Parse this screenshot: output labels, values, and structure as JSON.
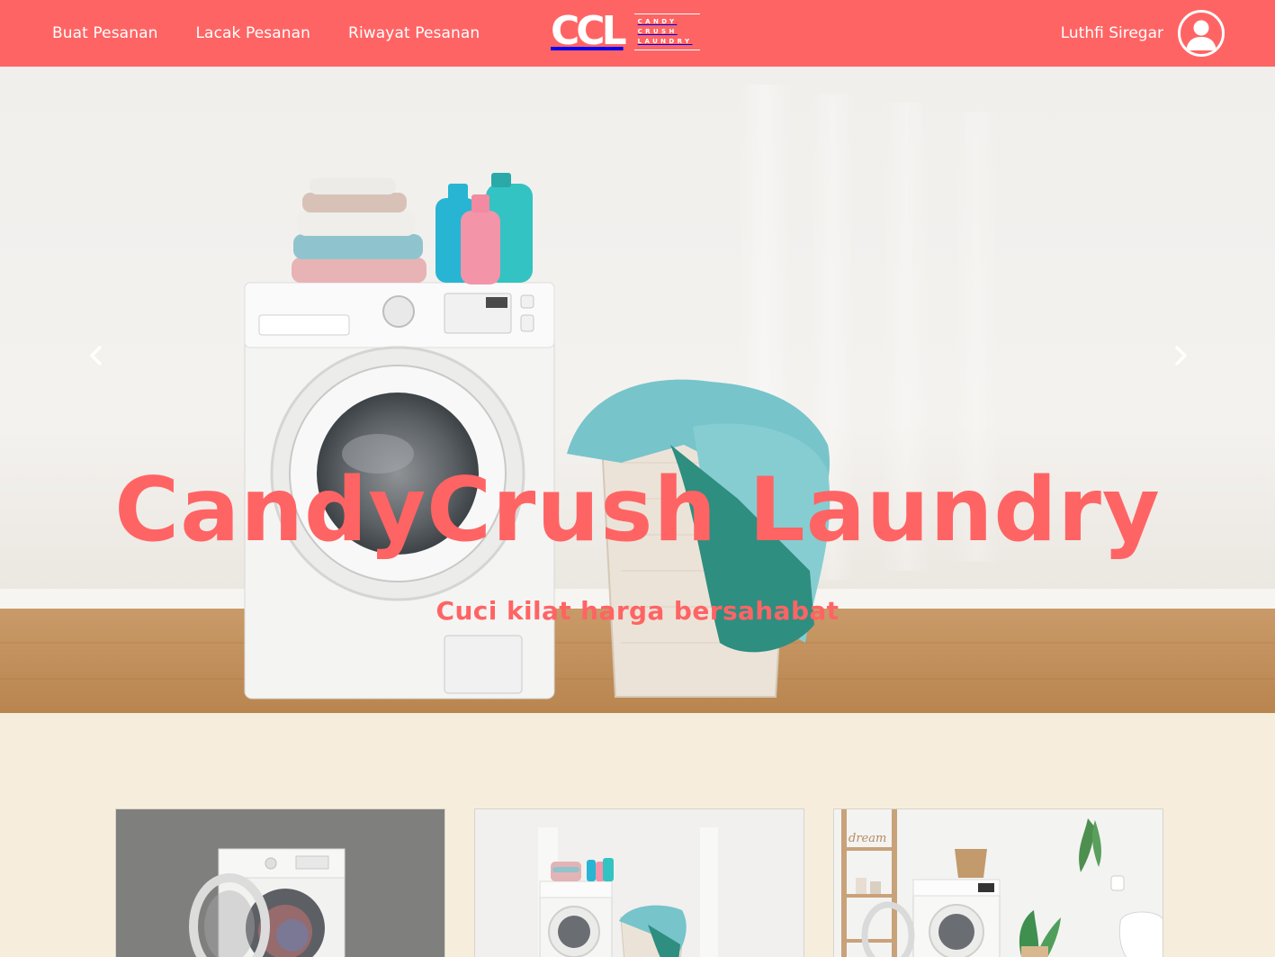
{
  "nav": {
    "links": [
      {
        "label": "Buat Pesanan"
      },
      {
        "label": "Lacak Pesanan"
      },
      {
        "label": "Riwayat Pesanan"
      }
    ],
    "brand": {
      "mark": "CCL",
      "words": [
        "CANDY",
        "CRUSH",
        "LAUNDRY"
      ]
    },
    "user": {
      "name": "Luthfi Siregar",
      "avatar_icon": "user-avatar-icon"
    }
  },
  "hero": {
    "title": "CandyCrush Laundry",
    "subtitle": "Cuci kilat harga bersahabat",
    "prev_icon": "chevron-left-icon",
    "next_icon": "chevron-right-icon"
  },
  "cards": [
    {
      "image": "washing-machine-open-door"
    },
    {
      "image": "washing-machine-with-basket"
    },
    {
      "image": "laundry-room-with-shelf"
    }
  ],
  "colors": {
    "primary": "#ff6464",
    "page_background": "#f6eddc",
    "white": "#ffffff"
  }
}
